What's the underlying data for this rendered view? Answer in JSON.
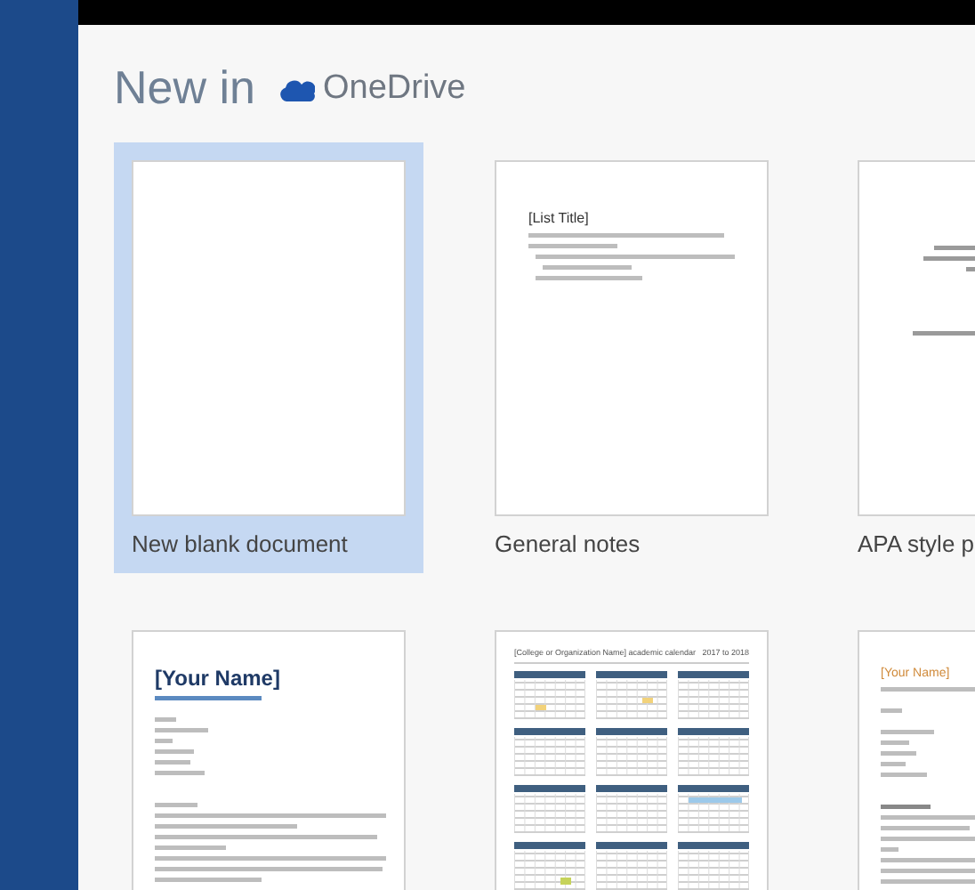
{
  "heading": {
    "text": "New in",
    "service": "OneDrive"
  },
  "templates": [
    {
      "label": "New blank document",
      "selected": true,
      "preview": {
        "kind": "blank"
      }
    },
    {
      "label": "General notes",
      "selected": false,
      "preview": {
        "kind": "notes",
        "title": "[List Title]"
      }
    },
    {
      "label": "APA style p",
      "selected": false,
      "preview": {
        "kind": "apa"
      }
    },
    {
      "selected": false,
      "preview": {
        "kind": "resume",
        "title": "[Your Name]"
      }
    },
    {
      "selected": false,
      "preview": {
        "kind": "calendar",
        "title": "[College or Organization Name] academic calendar",
        "years": "2017 to 2018"
      }
    },
    {
      "selected": false,
      "preview": {
        "kind": "letter",
        "title": "[Your Name]"
      }
    }
  ]
}
